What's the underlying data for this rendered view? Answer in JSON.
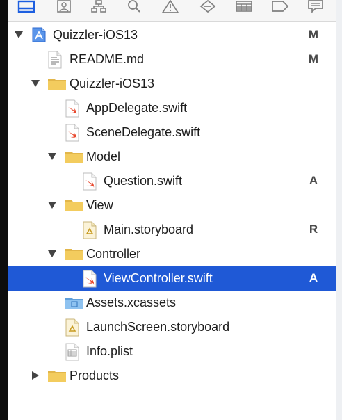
{
  "navigator": {
    "toolbar_icons": [
      "project-navigator-icon",
      "source-control-icon",
      "symbol-navigator-icon",
      "find-icon",
      "issue-icon",
      "test-icon",
      "debug-icon",
      "breakpoint-icon",
      "report-icon"
    ],
    "items": [
      {
        "label": "Quizzler-iOS13",
        "status": "M",
        "icon": "project-icon"
      },
      {
        "label": "README.md",
        "status": "M",
        "icon": "markdown-file-icon"
      },
      {
        "label": "Quizzler-iOS13",
        "status": "",
        "icon": "folder-icon"
      },
      {
        "label": "AppDelegate.swift",
        "status": "",
        "icon": "swift-file-icon"
      },
      {
        "label": "SceneDelegate.swift",
        "status": "",
        "icon": "swift-file-icon"
      },
      {
        "label": "Model",
        "status": "",
        "icon": "folder-icon"
      },
      {
        "label": "Question.swift",
        "status": "A",
        "icon": "swift-file-icon"
      },
      {
        "label": "View",
        "status": "",
        "icon": "folder-icon"
      },
      {
        "label": "Main.storyboard",
        "status": "R",
        "icon": "storyboard-file-icon"
      },
      {
        "label": "Controller",
        "status": "",
        "icon": "folder-icon"
      },
      {
        "label": "ViewController.swift",
        "status": "A",
        "icon": "swift-file-icon",
        "selected": true
      },
      {
        "label": "Assets.xcassets",
        "status": "",
        "icon": "assets-folder-icon"
      },
      {
        "label": "LaunchScreen.storyboard",
        "status": "",
        "icon": "storyboard-file-icon"
      },
      {
        "label": "Info.plist",
        "status": "",
        "icon": "plist-file-icon"
      },
      {
        "label": "Products",
        "status": "",
        "icon": "folder-icon"
      }
    ]
  }
}
